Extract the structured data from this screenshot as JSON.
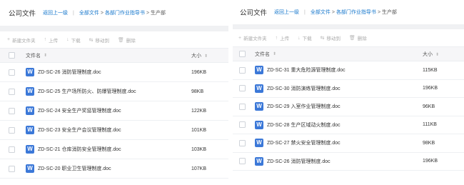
{
  "left": {
    "breadcrumb": {
      "title": "公司文件",
      "back": "返回上一级",
      "all": "全部文件",
      "folder": "各部门作业指导书",
      "current": "生产部"
    },
    "toolbar": {
      "new_folder": "新建文件夹",
      "upload": "上传",
      "download": "下载",
      "move": "移动到",
      "delete": "删除"
    },
    "columns": {
      "name": "文件名",
      "size": "大小"
    },
    "rows": [
      {
        "name": "ZD-SC-26 消防管理制度.doc",
        "size": "196KB"
      },
      {
        "name": "ZD-SC-25 生产场所防火、防爆管理制度.doc",
        "size": "98KB"
      },
      {
        "name": "ZD-SC-24 安全生产奖惩管理制度.doc",
        "size": "122KB"
      },
      {
        "name": "ZD-SC-23 安全生产会议管理制度.doc",
        "size": "101KB"
      },
      {
        "name": "ZD-SC-21 仓库消防安全管理制度.doc",
        "size": "103KB"
      },
      {
        "name": "ZD-SC-20 职业卫生管理制度.doc",
        "size": "107KB"
      }
    ]
  },
  "right": {
    "breadcrumb": {
      "title": "公司文件",
      "back": "返回上一级",
      "all": "全部文件",
      "folder": "各部门作业指导书",
      "current": "生产部"
    },
    "toolbar": {
      "new_folder": "新建文件夹",
      "upload": "上传",
      "download": "下载",
      "move": "移动到",
      "delete": "删除"
    },
    "columns": {
      "name": "文件名",
      "size": "大小"
    },
    "rows": [
      {
        "name": "ZD-SC-31 重大危险源管理制度.doc",
        "size": "115KB"
      },
      {
        "name": "ZD-SC-30 消防演练管理制度.doc",
        "size": "196KB"
      },
      {
        "name": "ZD-SC-29 入室作业管理制度.doc",
        "size": "96KB"
      },
      {
        "name": "ZD-SC-28 生产区域动火制度.doc",
        "size": "111KB"
      },
      {
        "name": "ZD-SC-27 禁火安全管理制度.doc",
        "size": "98KB"
      },
      {
        "name": "ZD-SC-26 消防管理制度.doc",
        "size": "196KB"
      }
    ]
  },
  "icons": {
    "word_file": "word-doc-icon",
    "file_glyph": "W",
    "sort_glyph": "⬍",
    "new_folder_glyph": "+",
    "upload_glyph": "↑",
    "download_glyph": "↓",
    "move_glyph": "⇆",
    "delete_glyph": "🗑"
  },
  "colors": {
    "link": "#1677cc",
    "word_icon": "#3b78d8",
    "band": "#f0f1f3"
  }
}
